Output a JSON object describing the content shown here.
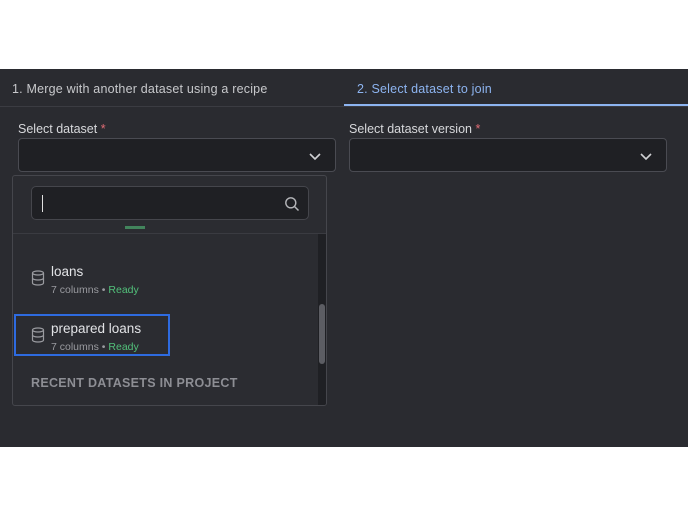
{
  "steps": [
    {
      "label": "1. Merge with another dataset using a recipe"
    },
    {
      "label": "2. Select dataset to join"
    }
  ],
  "form": {
    "dataset_label": "Select dataset",
    "version_label": "Select dataset version",
    "required_mark": "*"
  },
  "dropdown": {
    "items": [
      {
        "name": "loans",
        "columns": "7 columns",
        "separator": "•",
        "status": "Ready"
      },
      {
        "name": "prepared loans",
        "columns": "7 columns",
        "separator": "•",
        "status": "Ready"
      }
    ],
    "section_title": "RECENT DATASETS IN PROJECT"
  },
  "icons": {
    "dataset": "database-icon",
    "search": "search-icon",
    "chevron": "chevron-down-icon"
  },
  "colors": {
    "accent": "#8db4f0",
    "ready": "#52c07a",
    "highlight": "#2e6be0",
    "required": "#e06c75"
  }
}
